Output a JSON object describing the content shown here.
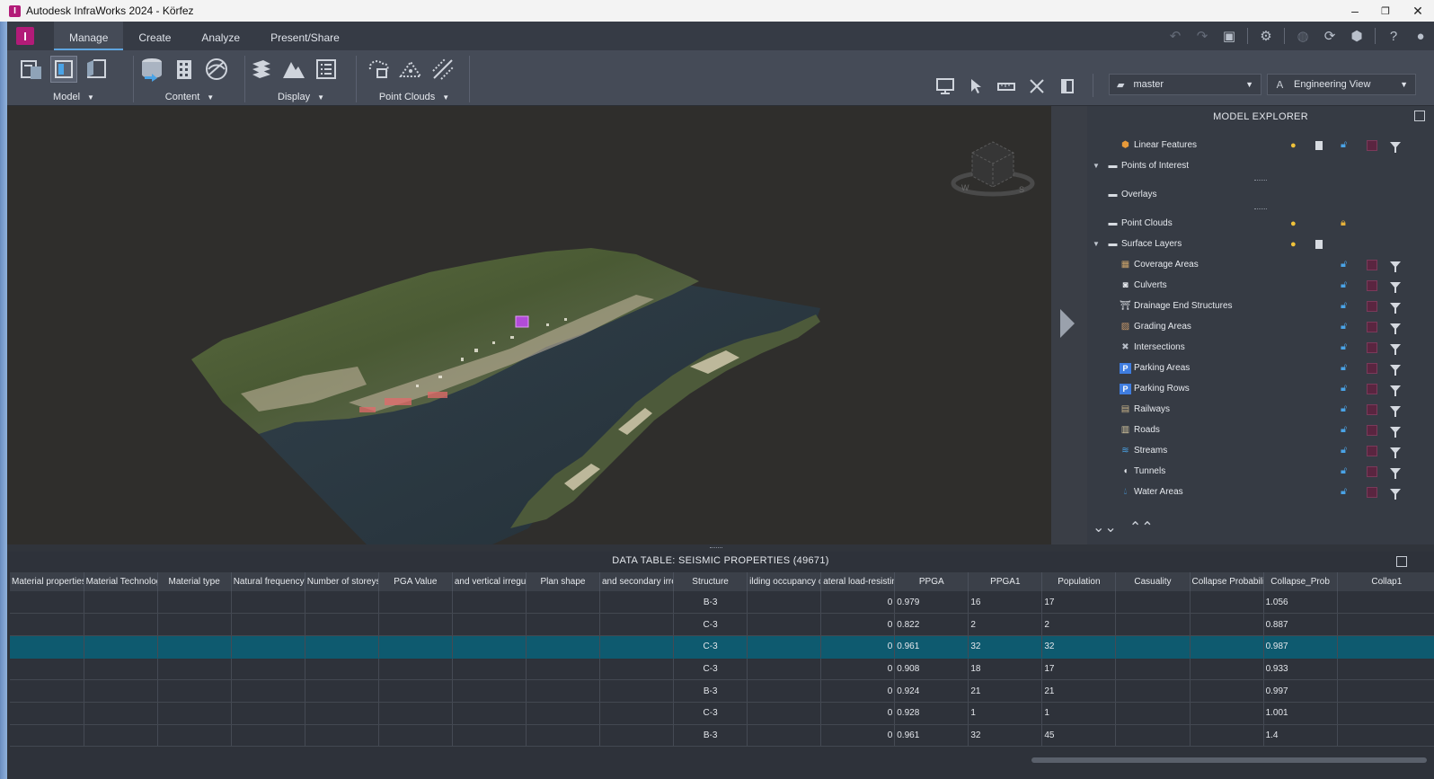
{
  "window": {
    "title": "Autodesk InfraWorks 2024 - Körfez",
    "badge": "I"
  },
  "app_logo": "I",
  "tabs": [
    "Manage",
    "Create",
    "Analyze",
    "Present/Share"
  ],
  "ribbon": {
    "groups": [
      "Model",
      "Content",
      "Display",
      "Point Clouds"
    ],
    "proposal": "master",
    "view_mode": "Engineering View"
  },
  "viewcube_labels": {
    "w": "W",
    "s": "S"
  },
  "explorer": {
    "title": "MODEL EXPLORER",
    "items": [
      {
        "label": "Linear Features",
        "icon": "linear-features-icon"
      },
      {
        "label": "Points of Interest",
        "icon": "folder-icon"
      },
      {
        "label": "Overlays",
        "icon": "folder-icon"
      },
      {
        "label": "Point Clouds",
        "icon": "folder-icon"
      },
      {
        "label": "Surface Layers",
        "icon": "folder-icon"
      },
      {
        "label": "Coverage Areas",
        "icon": "coverage-areas-icon"
      },
      {
        "label": "Culverts",
        "icon": "culverts-icon"
      },
      {
        "label": "Drainage End Structures",
        "icon": "drainage-end-structures-icon"
      },
      {
        "label": "Grading Areas",
        "icon": "grading-areas-icon"
      },
      {
        "label": "Intersections",
        "icon": "intersections-icon"
      },
      {
        "label": "Parking Areas",
        "icon": "parking-icon"
      },
      {
        "label": "Parking Rows",
        "icon": "parking-icon"
      },
      {
        "label": "Railways",
        "icon": "railways-icon"
      },
      {
        "label": "Roads",
        "icon": "roads-icon"
      },
      {
        "label": "Streams",
        "icon": "streams-icon"
      },
      {
        "label": "Tunnels",
        "icon": "tunnels-icon"
      },
      {
        "label": "Water Areas",
        "icon": "water-areas-icon"
      }
    ]
  },
  "data_table": {
    "title": "DATA TABLE: SEISMIC PROPERTIES (49671)",
    "columns": [
      "Material properties",
      "Material Technology",
      "Material type",
      "Natural frequency",
      "Number of storeys",
      "PGA Value",
      "and vertical irregul",
      "Plan shape",
      "and secondary irre",
      "Structure",
      "ilding occupancy cl",
      "ateral load-resisting",
      "PPGA",
      "PPGA1",
      "Population",
      "Casuality",
      "Collapse Probability",
      "Collapse_Prob",
      "Collap1"
    ],
    "rows": [
      {
        "structure": "B-3",
        "ppga": "0",
        "ppga1": "0.979",
        "population": "16",
        "casuality": "17",
        "collap1": "1.056"
      },
      {
        "structure": "C-3",
        "ppga": "0",
        "ppga1": "0.822",
        "population": "2",
        "casuality": "2",
        "collap1": "0.887"
      },
      {
        "structure": "C-3",
        "ppga": "0",
        "ppga1": "0.961",
        "population": "32",
        "casuality": "32",
        "collap1": "0.987"
      },
      {
        "structure": "C-3",
        "ppga": "0",
        "ppga1": "0.908",
        "population": "18",
        "casuality": "17",
        "collap1": "0.933"
      },
      {
        "structure": "B-3",
        "ppga": "0",
        "ppga1": "0.924",
        "population": "21",
        "casuality": "21",
        "collap1": "0.997"
      },
      {
        "structure": "C-3",
        "ppga": "0",
        "ppga1": "0.928",
        "population": "1",
        "casuality": "1",
        "collap1": "1.001"
      },
      {
        "structure": "B-3",
        "ppga": "0",
        "ppga1": "0.961",
        "population": "32",
        "casuality": "45",
        "collap1": "1.4"
      }
    ],
    "selected_row": 2
  },
  "colors": {
    "accent": "#5fa5e0",
    "brand": "#b21b78",
    "selection": "#0e5a6f"
  }
}
